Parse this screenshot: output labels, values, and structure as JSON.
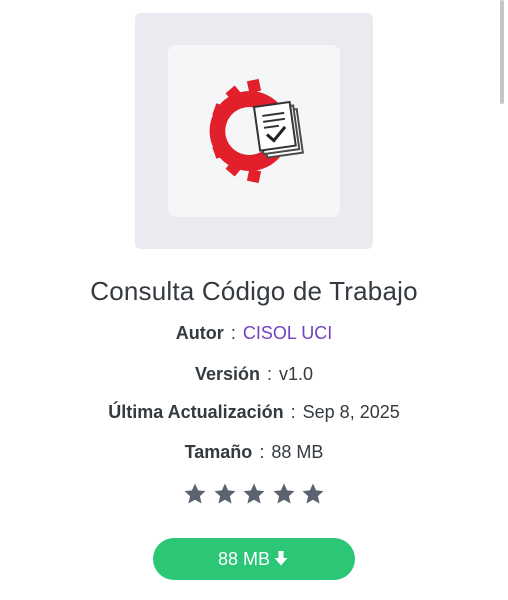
{
  "app": {
    "title": "Consulta Código de Trabajo",
    "icon": "cisol-gear-document-logo"
  },
  "details": {
    "author_label": "Autor",
    "author_value": "CISOL UCI",
    "version_label": "Versión",
    "version_value": "v1.0",
    "updated_label": "Última Actualización",
    "updated_value": "Sep 8, 2025",
    "size_label": "Tamaño",
    "size_value": "88 MB",
    "separator": ":"
  },
  "rating": {
    "stars": 5,
    "icon": "star-icon"
  },
  "download": {
    "label": "88 MB",
    "icon": "download-arrow-icon"
  },
  "colors": {
    "accent_green": "#2cc776",
    "author_link": "#6f42c1",
    "logo_red": "#e2202b",
    "star_gray": "#5b6270"
  }
}
